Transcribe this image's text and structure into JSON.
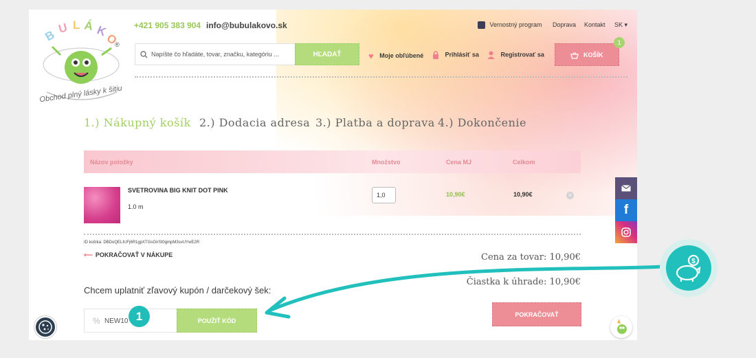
{
  "header": {
    "phone": "+421 905 383 904",
    "email": "info@bubulakovo.sk",
    "top_links": [
      {
        "label": "Vernostný program",
        "icon": "loyalty-icon"
      },
      {
        "label": "Doprava"
      },
      {
        "label": "Kontakt"
      },
      {
        "label": "SK ▾"
      }
    ],
    "search": {
      "placeholder": "Napíšte čo hľadáte, tovar, značku, kategóriu ...",
      "button_label": "HĽADAŤ"
    },
    "account": {
      "favorites": "Moje obľúbené",
      "login": "Prihlásiť sa",
      "register": "Registrovať sa"
    },
    "cart": {
      "label": "KOŠÍK",
      "count": "1"
    },
    "logo": {
      "brand_letters": "BULÁKO",
      "tagline": "Obchod plný lásky k šitiu",
      "mark": "®"
    }
  },
  "steps": [
    {
      "label": "1.) Nákupný košík",
      "active": true
    },
    {
      "label": "2.) Dodacia adresa",
      "active": false
    },
    {
      "label": "3.) Platba a doprava",
      "active": false
    },
    {
      "label": "4.) Dokončenie",
      "active": false
    }
  ],
  "table": {
    "columns": [
      "Názov položky",
      "Množstvo",
      "Cena MJ",
      "Celkom"
    ],
    "rows": [
      {
        "name": "SVETROVINA BIG KNIT DOT PINK",
        "size": "1.0 m",
        "qty": "1,0",
        "unit_price": "10,90€",
        "total": "10,90€"
      }
    ]
  },
  "cart_id": "ID košíka: DBDoQELIUFj6R1gpXTGsGIrSt0gmpM3svUYwE2R",
  "continue_shopping": "POKRAČOVAŤ V NÁKUPE",
  "summary": {
    "goods": "Cena za tovar: 10,90€",
    "to_pay": "Čiastka k úhrade: 10,90€"
  },
  "coupon": {
    "label": "Chcem uplatniť zľavový kupón / darčekový šek:",
    "value": "NEW10",
    "button_label": "POUŽIŤ KÓD"
  },
  "proceed_label": "POKRAČOVAŤ",
  "annotation": {
    "marker": "1"
  },
  "colors": {
    "accent_green": "#b4dc7c",
    "accent_pink": "#ed8e97",
    "annotation_teal": "#21c0bc",
    "step_active": "#a3cf62"
  }
}
